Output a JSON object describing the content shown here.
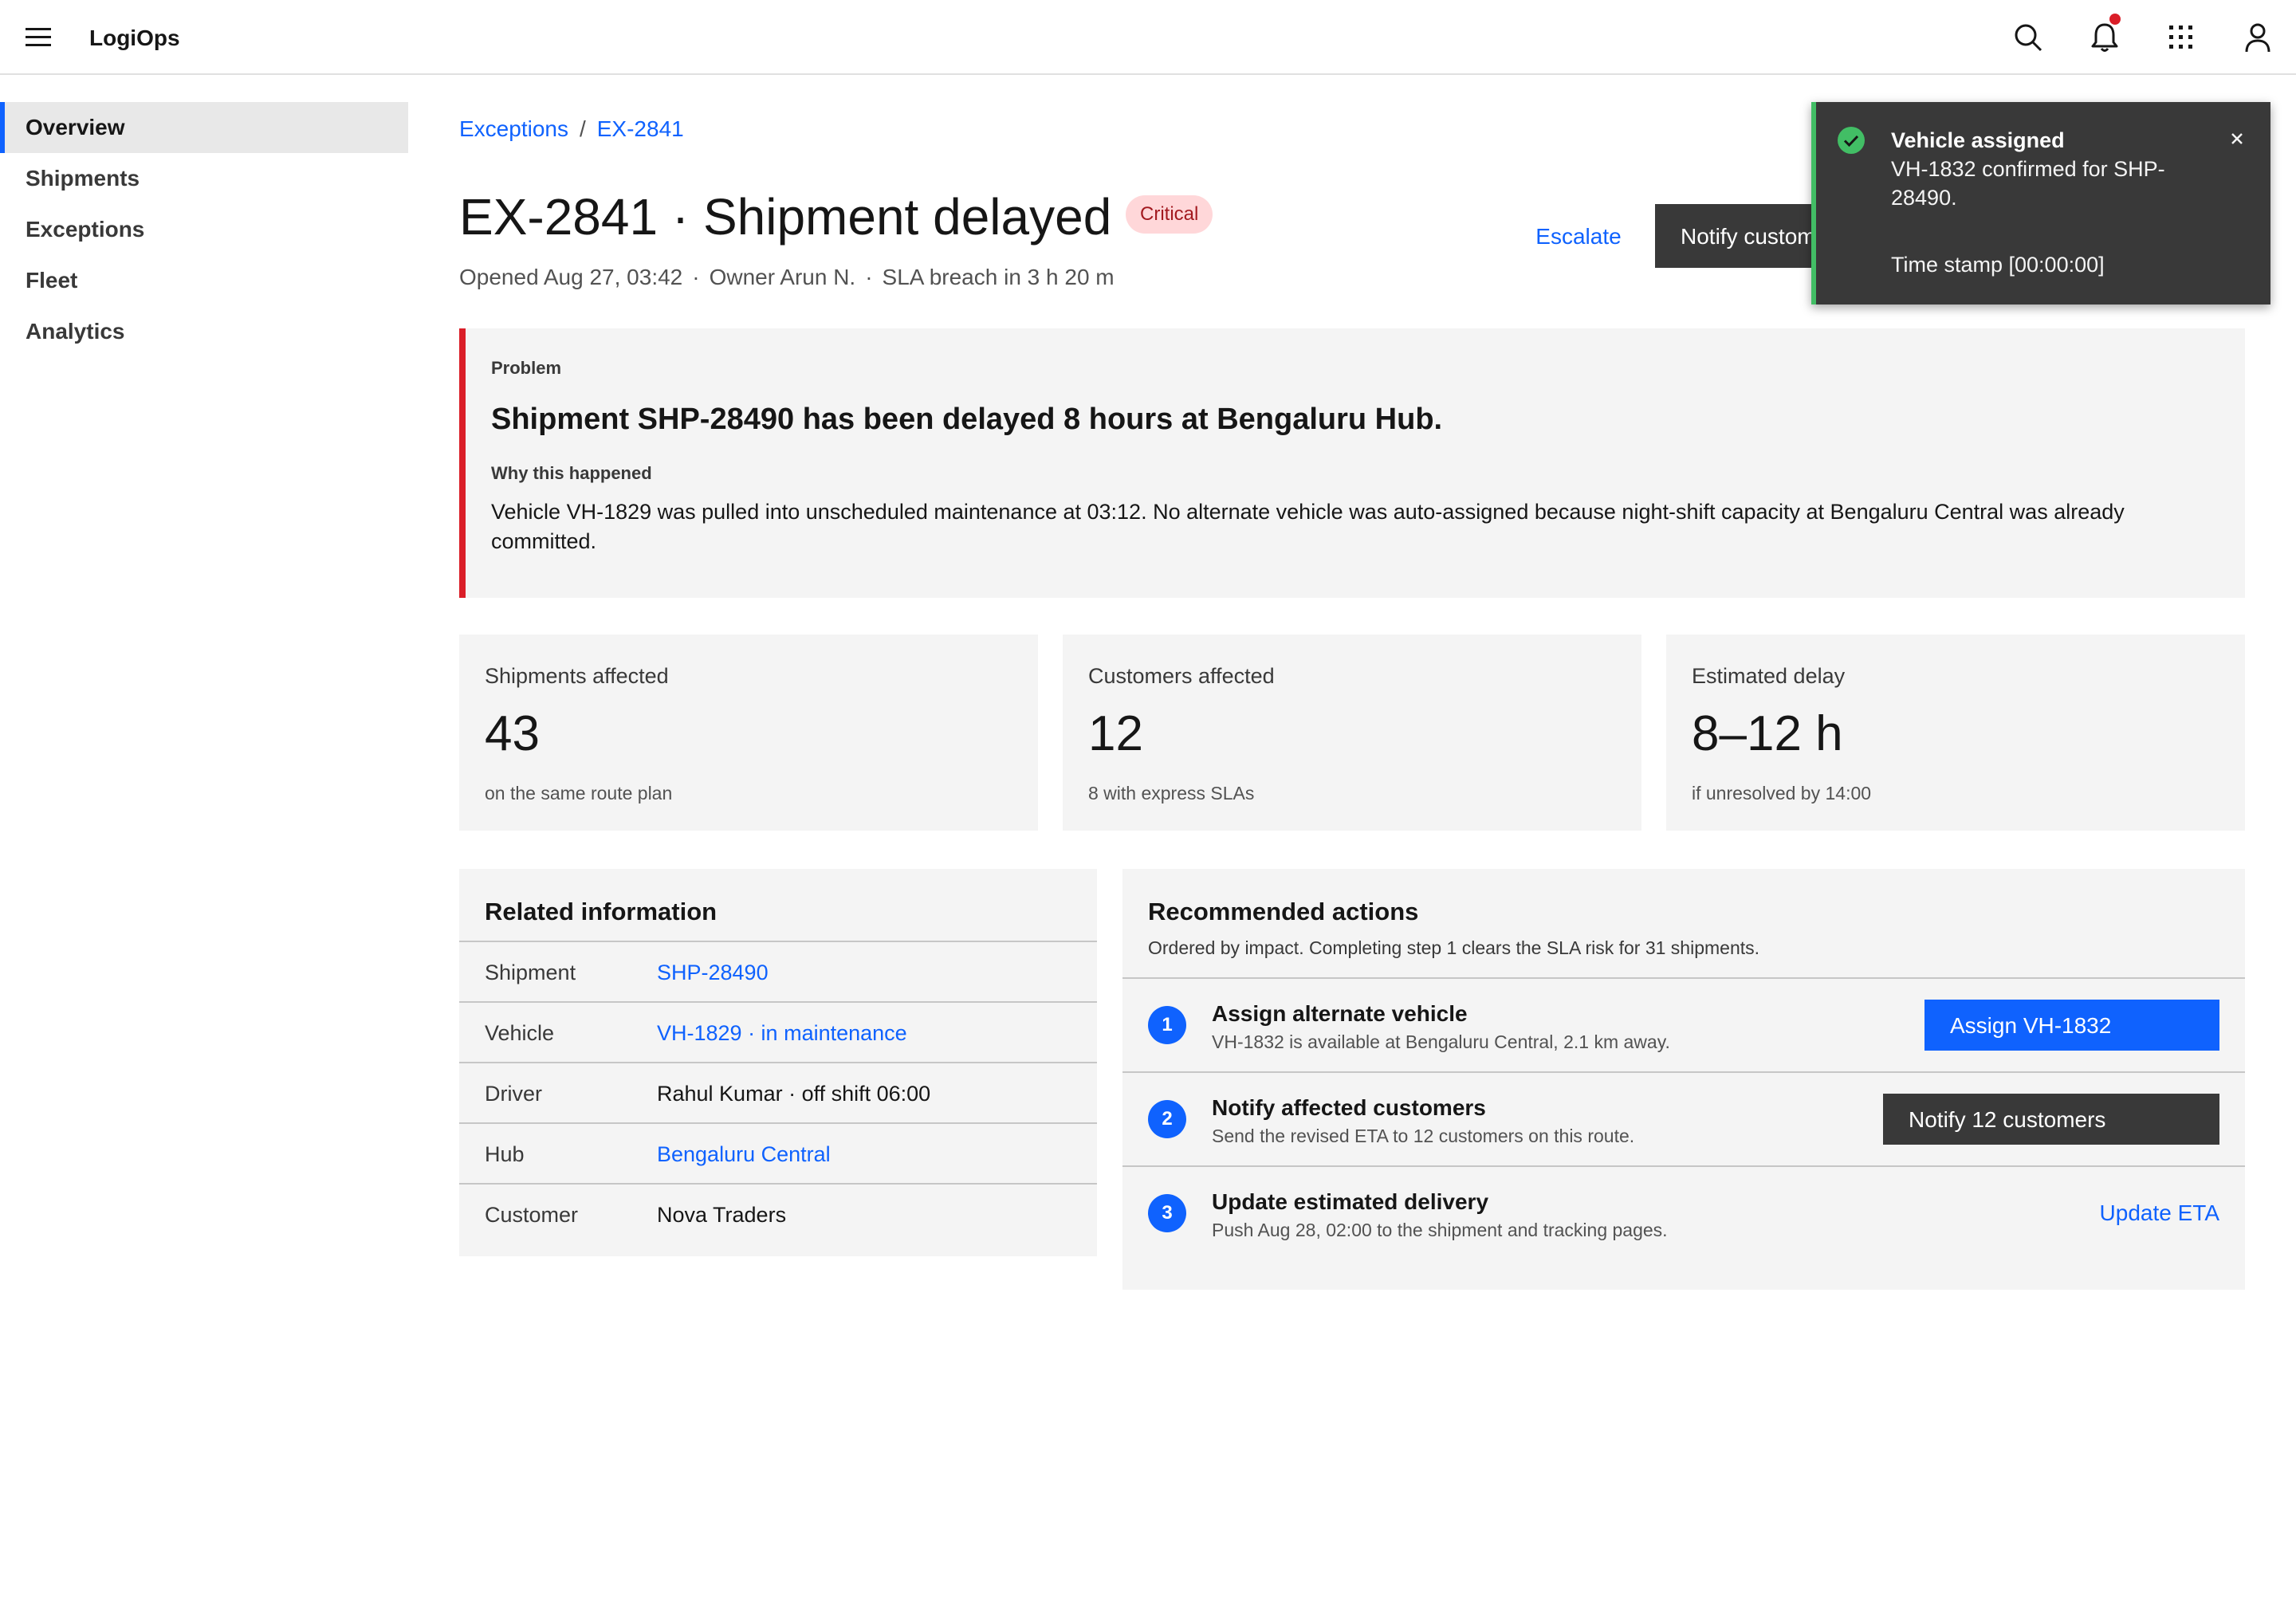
{
  "app": {
    "name": "LogiOps"
  },
  "header": {
    "icons": [
      "search-icon",
      "notification-icon",
      "app-switcher-icon",
      "user-icon"
    ],
    "notification_dot_color": "#da1e28"
  },
  "sidebar": {
    "items": [
      {
        "label": "Overview",
        "active": true
      },
      {
        "label": "Shipments"
      },
      {
        "label": "Exceptions"
      },
      {
        "label": "Fleet"
      },
      {
        "label": "Analytics"
      }
    ]
  },
  "breadcrumb": {
    "items": [
      "Exceptions",
      "EX-2841"
    ],
    "separator": "/"
  },
  "page": {
    "title": "EX-2841 · Shipment delayed",
    "badge": "Critical",
    "meta": [
      "Opened Aug 27, 03:42",
      "Owner Arun N.",
      "SLA breach in 3 h 20 m"
    ],
    "meta_separator": "·",
    "escalate_label": "Escalate",
    "notify_label": "Notify customers"
  },
  "problem": {
    "label": "Problem",
    "headline": "Shipment SHP-28490 has been delayed 8 hours at Bengaluru Hub.",
    "why_label": "Why this happened",
    "body": "Vehicle VH-1829 was pulled into unscheduled maintenance at 03:12. No alternate vehicle was auto-assigned because night-shift capacity at Bengaluru Central was already committed."
  },
  "stats": [
    {
      "label": "Shipments affected",
      "value": "43",
      "sub": "on the same route plan"
    },
    {
      "label": "Customers affected",
      "value": "12",
      "sub": "8 with express SLAs"
    },
    {
      "label": "Estimated delay",
      "value": "8–12 h",
      "sub": "if unresolved by 14:00"
    }
  ],
  "related": {
    "title": "Related information",
    "rows": [
      {
        "key": "Shipment",
        "value": "SHP-28490",
        "link": true
      },
      {
        "key": "Vehicle",
        "value": "VH-1829 · in maintenance",
        "link": true
      },
      {
        "key": "Driver",
        "value": "Rahul Kumar · off shift 06:00",
        "link": false
      },
      {
        "key": "Hub",
        "value": "Bengaluru Central",
        "link": true
      },
      {
        "key": "Customer",
        "value": "Nova Traders",
        "link": false
      }
    ]
  },
  "actions": {
    "title": "Recommended actions",
    "subtitle": "Ordered by impact. Completing step 1 clears the SLA risk for 31 shipments.",
    "steps": [
      {
        "num": "1",
        "title": "Assign alternate vehicle",
        "desc": "VH-1832 is available at Bengaluru Central, 2.1 km away.",
        "button": "Assign VH-1832"
      },
      {
        "num": "2",
        "title": "Notify affected customers",
        "desc": "Send the revised ETA to 12 customers on this route.",
        "button": "Notify 12 customers"
      },
      {
        "num": "3",
        "title": "Update estimated delivery",
        "desc": "Push Aug 28, 02:00 to the shipment and tracking pages.",
        "button": "Update ETA"
      }
    ]
  },
  "toast": {
    "title": "Vehicle assigned",
    "body": "VH-1832 confirmed for SHP-28490.",
    "timestamp": "Time stamp [00:00:00]",
    "status_color": "#42be65"
  },
  "colors": {
    "accent": "#0f62fe",
    "danger": "#da1e28",
    "success": "#42be65",
    "panel": "#f4f4f4",
    "dark_button": "#393939"
  }
}
